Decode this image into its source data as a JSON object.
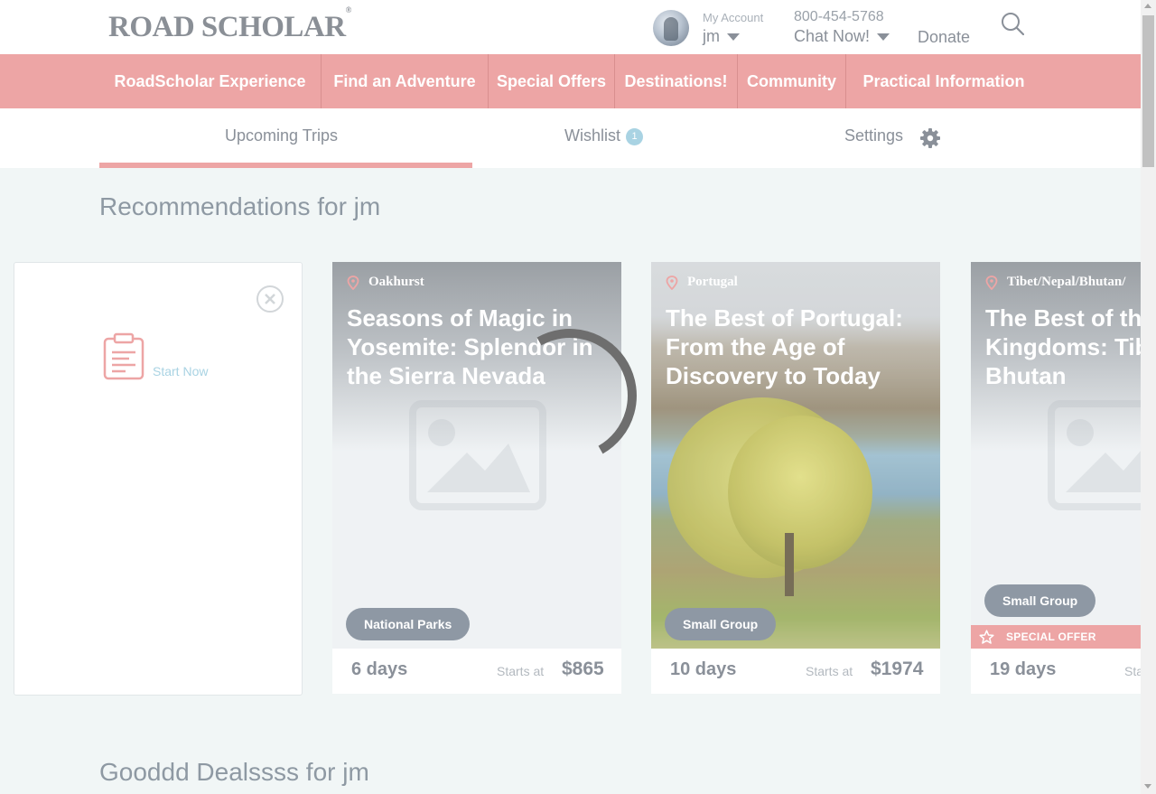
{
  "header": {
    "logo": "ROAD SCHOLAR",
    "logo_mark": "®",
    "account_label": "My Account",
    "account_name": "jm",
    "phone": "800-454-5768",
    "chat": "Chat Now!",
    "donate": "Donate"
  },
  "nav": [
    "RoadScholar Experience",
    "Find an Adventure",
    "Special Offers",
    "Destinations!",
    "Community",
    "Practical Information"
  ],
  "tabs": {
    "upcoming": "Upcoming Trips",
    "wishlist": "Wishlist",
    "wishlist_count": "1",
    "settings": "Settings"
  },
  "recommendations": {
    "title": "Recommendations for jm",
    "survey_cta": "Start Now",
    "trips": [
      {
        "location": "Oakhurst",
        "title": "Seasons of Magic in Yosemite: Splendor in the Sierra Nevada",
        "tag": "National Parks",
        "days": "6 days",
        "starts_label": "Starts at",
        "price": "$865"
      },
      {
        "location": "Portugal",
        "title": "The Best of Portugal: From the Age of Discovery to Today",
        "tag": "Small Group",
        "days": "10 days",
        "starts_label": "Starts at",
        "price": "$1974"
      },
      {
        "location": "Tibet/Nepal/Bhutan/",
        "title": "The Best of the Kingdoms: Tibet and Bhutan",
        "tag": "Small Group",
        "special": "SPECIAL OFFER",
        "days": "19 days",
        "starts_label": "Sta"
      }
    ]
  },
  "deals": {
    "title": "Gooddd Dealssss for jm"
  },
  "colors": {
    "accent": "#eda5a5",
    "badge": "#a9d3e3",
    "text": "#8a9099",
    "tag": "#8e98a4"
  }
}
